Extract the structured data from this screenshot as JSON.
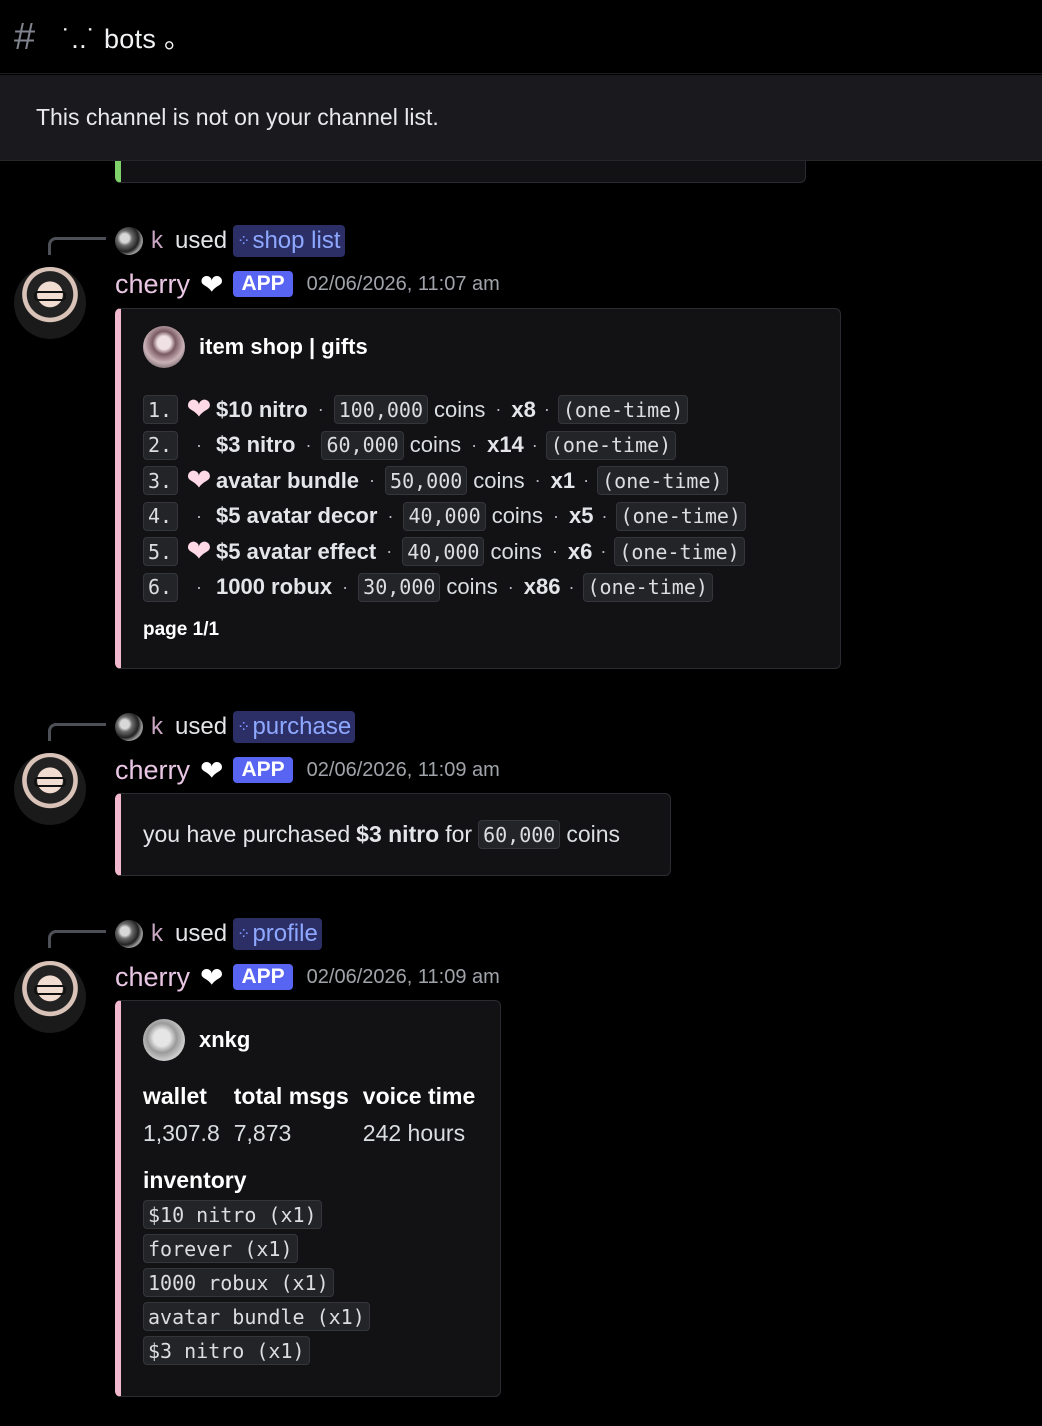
{
  "channel": {
    "name": "˙..˙ bots 。",
    "notice": "This channel is not on your channel list."
  },
  "colors": {
    "accent_pink": "#f2b8cd",
    "app_badge": "#5865f2",
    "command_chip": "#2b2f66",
    "prev_embed": "#7fd16a"
  },
  "messages": [
    {
      "invoker": "k",
      "used": "used",
      "command": "shop list",
      "author": "cherry",
      "badge": "APP",
      "timestamp": "02/06/2026, 11:07 am",
      "embed": {
        "author": "item shop | gifts",
        "rows": [
          {
            "n": "1.",
            "icon": "heart",
            "item": "$10 nitro",
            "price": "100,000",
            "unit": "coins",
            "qty": "x8",
            "type": "(one-time)"
          },
          {
            "n": "2.",
            "icon": "dot",
            "item": "$3 nitro",
            "price": "60,000",
            "unit": "coins",
            "qty": "x14",
            "type": "(one-time)"
          },
          {
            "n": "3.",
            "icon": "heart",
            "item": "avatar bundle",
            "price": "50,000",
            "unit": "coins",
            "qty": "x1",
            "type": "(one-time)"
          },
          {
            "n": "4.",
            "icon": "dot",
            "item": "$5 avatar decor",
            "price": "40,000",
            "unit": "coins",
            "qty": "x5",
            "type": "(one-time)"
          },
          {
            "n": "5.",
            "icon": "heart",
            "item": "$5 avatar effect",
            "price": "40,000",
            "unit": "coins",
            "qty": "x6",
            "type": "(one-time)"
          },
          {
            "n": "6.",
            "icon": "dot",
            "item": "1000 robux",
            "price": "30,000",
            "unit": "coins",
            "qty": "x86",
            "type": "(one-time)"
          }
        ],
        "footer": "page 1/1"
      }
    },
    {
      "invoker": "k",
      "used": "used",
      "command": "purchase",
      "author": "cherry",
      "badge": "APP",
      "timestamp": "02/06/2026, 11:09 am",
      "embed": {
        "pre": "you have purchased",
        "item": "$3 nitro",
        "mid": "for",
        "amount": "60,000",
        "unit": "coins"
      }
    },
    {
      "invoker": "k",
      "used": "used",
      "command": "profile",
      "author": "cherry",
      "badge": "APP",
      "timestamp": "02/06/2026, 11:09 am",
      "embed": {
        "author": "xnkg",
        "fields": [
          {
            "name": "wallet",
            "value": "1,307.8"
          },
          {
            "name": "total msgs",
            "value": "7,873"
          },
          {
            "name": "voice time",
            "value": "242 hours"
          }
        ],
        "inventory_title": "inventory",
        "inventory": [
          "$10 nitro (x1)",
          "forever (x1)",
          "1000 robux (x1)",
          "avatar bundle (x1)",
          "$3 nitro (x1)"
        ]
      }
    }
  ]
}
